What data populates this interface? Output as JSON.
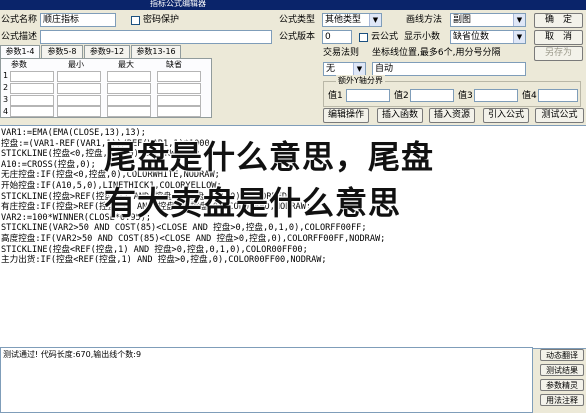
{
  "window": {
    "title": "指标公式编辑器"
  },
  "top": {
    "name_label": "公式名称",
    "name_value": "顺庄指标",
    "pwd_checkbox_label": "密码保护",
    "desc_label": "公式描述",
    "desc_value": "",
    "type_label": "公式类型",
    "type_value": "其他类型",
    "draw_label": "画线方法",
    "draw_value": "副图",
    "version_label": "公式版本",
    "version_value": "0",
    "cloud_label": "云公式",
    "decimals_label": "显示小数",
    "decimals_value": "缺省位数",
    "trade_rule_label": "交易法则",
    "coord_label": "坐标线位置,最多6个,用分号分隔",
    "trade_rule_value": "无",
    "coord_value": "自动",
    "extra_y_label": "额外Y轴分界",
    "val1_label": "值1",
    "val2_label": "值2",
    "val3_label": "值3",
    "val4_label": "值4"
  },
  "buttons": {
    "confirm": "确　定",
    "cancel": "取　消",
    "save_as": "另存为",
    "edit_op": "编辑操作",
    "insert_func": "插入函数",
    "insert_res": "插入资源",
    "import_formula": "引入公式",
    "test_formula": "测试公式"
  },
  "tabs": [
    "参数1-4",
    "参数5-8",
    "参数9-12",
    "参数13-16"
  ],
  "param_table": {
    "headers": [
      "参数",
      "最小",
      "最大",
      "缺省"
    ],
    "rows": [
      "1",
      "2",
      "3",
      "4"
    ]
  },
  "code_lines": [
    "VAR1:=EMA(EMA(CLOSE,13),13);",
    "控盘:=(VAR1-REF(VAR1,1))/REF(VAR1,1)*1000;",
    "STICKLINE(控盘<0,控盘,0,1,0),COLORWHITE;",
    "A10:=CROSS(控盘,0);",
    "无庄控盘:IF(控盘<0,控盘,0),COLORWHITE,NODRAW;",
    "开始控盘:IF(A10,5,0),LINETHICK1,COLORYELLOW;",
    "STICKLINE(控盘>REF(控盘,1) AND 控盘>0,控盘,0,1,0),COLORRED;",
    "有庄控盘:IF(控盘>REF(控盘,1) AND 控盘>0,控盘,0),COLORRED,NODRAW;",
    "VAR2:=100*WINNER(CLOSE*0.95);",
    "STICKLINE(VAR2>50 AND COST(85)<CLOSE AND 控盘>0,控盘,0,1,0),COLORFF00FF;",
    "高度控盘:IF(VAR2>50 AND COST(85)<CLOSE AND 控盘>0,控盘,0),COLORFF00FF,NODRAW;",
    "STICKLINE(控盘<REF(控盘,1) AND 控盘>0,控盘,0,1,0),COLOR00FF00;",
    "主力出货:IF(控盘<REF(控盘,1) AND 控盘>0,控盘,0),COLOR00FF00,NODRAW;"
  ],
  "overlay": {
    "line1": "尾盘是什么意思，尾盘",
    "line2": "有大卖盘是什么意思"
  },
  "status": {
    "text": "测试通过! 代码长度:670,输出线个数:9"
  },
  "right_buttons": [
    "动态翻译",
    "测试结果",
    "参数精灵",
    "用法注释"
  ],
  "colors": {
    "title_bar": "#0a246a",
    "dialog_bg": "#ece9d8",
    "code_text": "#000000"
  }
}
